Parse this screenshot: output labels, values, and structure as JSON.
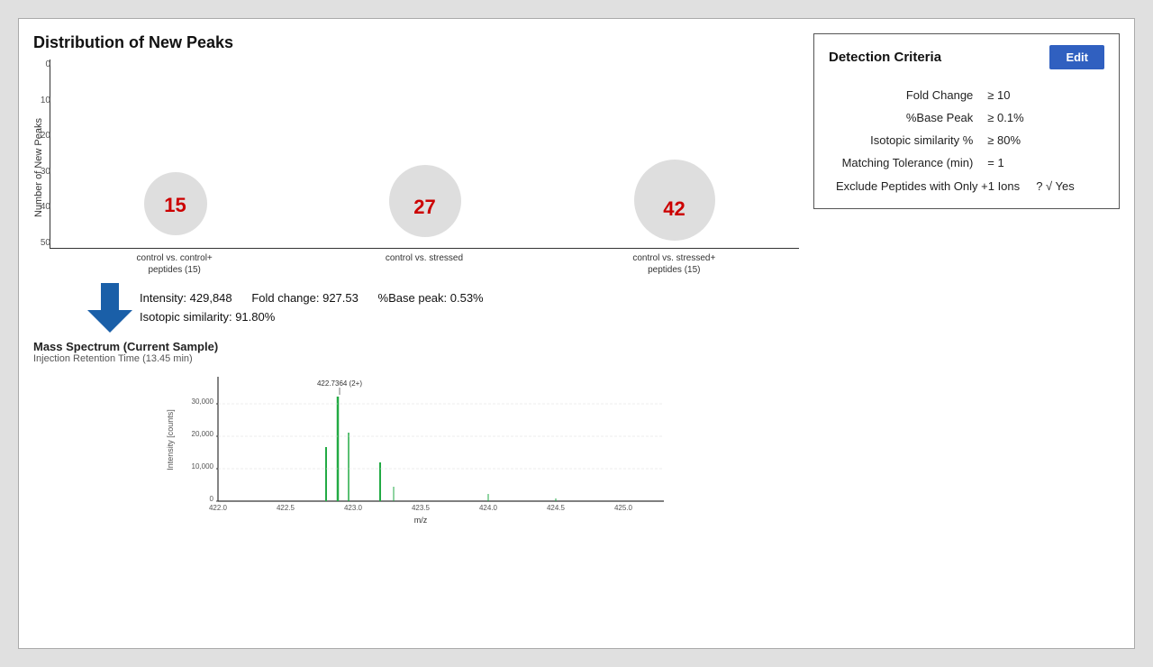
{
  "page": {
    "title": "Distribution of New Peaks",
    "chart": {
      "y_axis_label": "Number of New Peaks",
      "y_ticks": [
        "0",
        "10",
        "20",
        "30",
        "40",
        "50"
      ],
      "bars": [
        {
          "label": "control vs. control+\npeptides (15)",
          "value": 15,
          "height_pct": 30,
          "bubble_number": "15"
        },
        {
          "label": "control vs. stressed",
          "value": 27,
          "height_pct": 54,
          "bubble_number": "27"
        },
        {
          "label": "control vs. stressed+\npeptides (15)",
          "value": 42,
          "height_pct": 84,
          "bubble_number": "42"
        }
      ]
    },
    "stats": {
      "intensity_label": "Intensity:",
      "intensity_value": "429,848",
      "fold_change_label": "Fold change:",
      "fold_change_value": "927.53",
      "base_peak_label": "%Base peak:",
      "base_peak_value": "0.53%",
      "isotopic_label": "Isotopic similarity:",
      "isotopic_value": "91.80%"
    },
    "spectrum": {
      "title": "Mass Spectrum (Current Sample)",
      "subtitle": "Injection Retention Time (13.45 min)",
      "peak_label": "422.7364 (2+)",
      "x_axis_label": "m/z",
      "y_axis_label": "Intensity [counts]",
      "x_ticks": [
        "422.0",
        "422.5",
        "423.0",
        "423.5",
        "424.0",
        "424.5",
        "425.0"
      ],
      "y_ticks": [
        "0",
        "10,000",
        "20,000",
        "30,000"
      ]
    },
    "criteria": {
      "title": "Detection Criteria",
      "edit_button": "Edit",
      "rows": [
        {
          "label": "Fold Change",
          "value": "≥ 10"
        },
        {
          "label": "%Base Peak",
          "value": "≥ 0.1%"
        },
        {
          "label": "Isotopic similarity %",
          "value": "≥ 80%"
        },
        {
          "label": "Matching Tolerance (min)",
          "value": "= 1"
        },
        {
          "label": "Exclude Peptides with Only +1 Ions",
          "value": "? √ Yes"
        }
      ]
    }
  }
}
